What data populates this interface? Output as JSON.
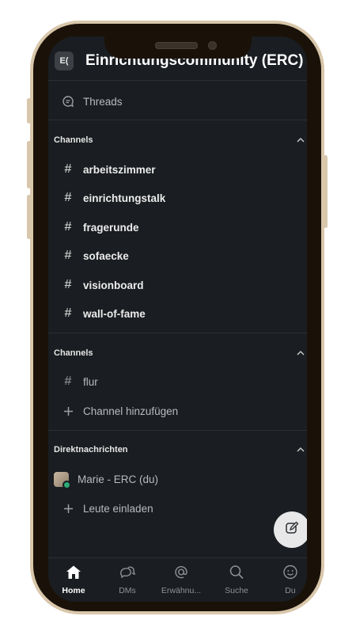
{
  "workspace": {
    "icon_text": "E(",
    "name": "Einrichtungscommunity (ERC)"
  },
  "threads": {
    "label": "Threads",
    "icon": "threads-icon"
  },
  "sections": [
    {
      "title": "Channels",
      "channels": [
        {
          "name": "arbeitszimmer",
          "unread": true
        },
        {
          "name": "einrichtungstalk",
          "unread": true
        },
        {
          "name": "fragerunde",
          "unread": true
        },
        {
          "name": "sofaecke",
          "unread": true
        },
        {
          "name": "visionboard",
          "unread": true
        },
        {
          "name": "wall-of-fame",
          "unread": true
        }
      ]
    },
    {
      "title": "Channels",
      "channels": [
        {
          "name": "flur",
          "unread": false
        }
      ],
      "add_label": "Channel hinzufügen"
    },
    {
      "title": "Direktnachrichten",
      "dms": [
        {
          "name": "Marie - ERC (du)",
          "status": "online"
        }
      ],
      "add_label": "Leute einladen"
    }
  ],
  "tabs": [
    {
      "label": "Home",
      "icon": "home-icon",
      "active": true
    },
    {
      "label": "DMs",
      "icon": "dms-icon",
      "active": false
    },
    {
      "label": "Erwähnu...",
      "icon": "mention-icon",
      "active": false
    },
    {
      "label": "Suche",
      "icon": "search-icon",
      "active": false
    },
    {
      "label": "Du",
      "icon": "profile-icon",
      "active": false
    }
  ],
  "colors": {
    "background": "#1a1d21",
    "online": "#2bac76",
    "phone_frame": "#d9c7ab"
  }
}
